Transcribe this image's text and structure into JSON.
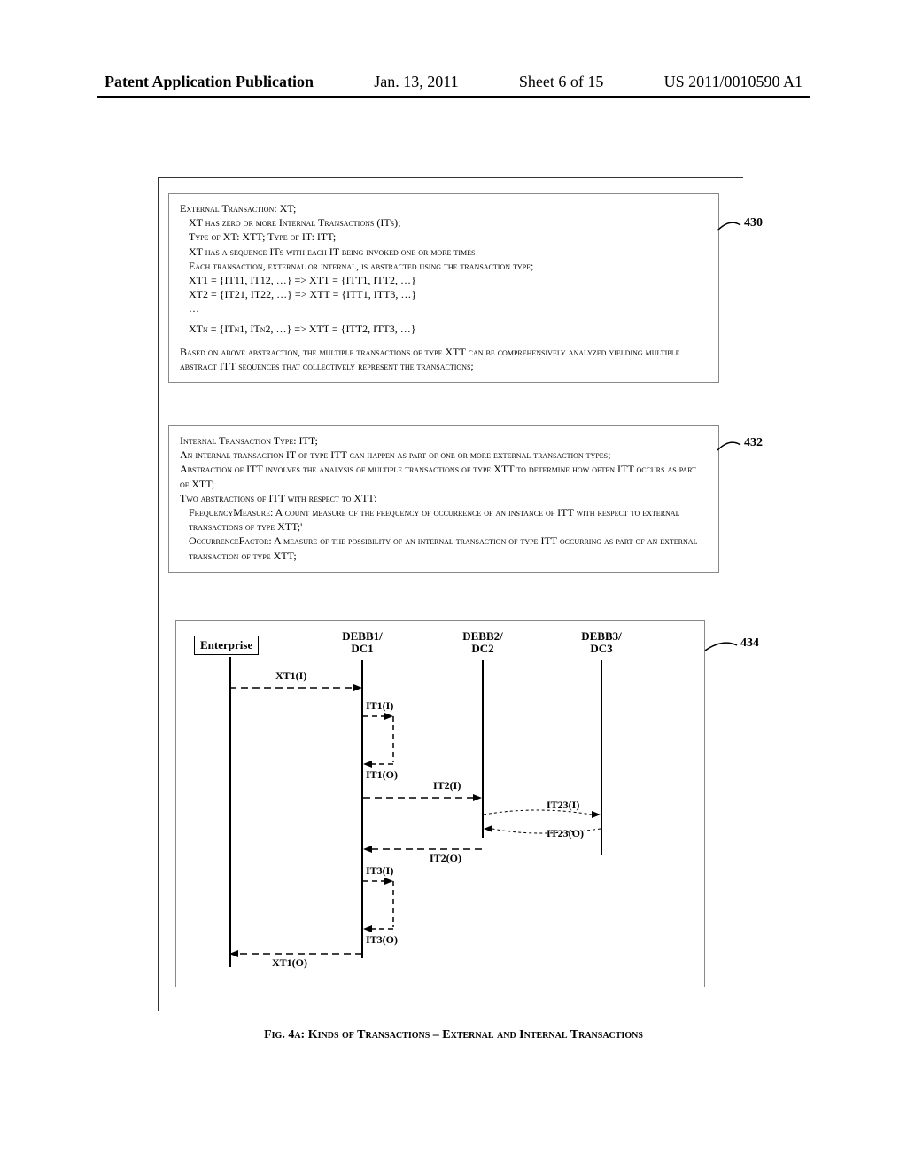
{
  "header": {
    "left": "Patent Application Publication",
    "date": "Jan. 13, 2011",
    "sheet": "Sheet 6 of 15",
    "pubno": "US 2011/0010590 A1"
  },
  "refs": {
    "r430": "430",
    "r432": "432",
    "r434": "434"
  },
  "box430": {
    "l1": "External Transaction: XT;",
    "l2": "XT has zero or more Internal Transactions (ITs);",
    "l3": "Type of XT: XTT; Type of IT: ITT;",
    "l4": "XT has a sequence ITs with each IT being invoked one or more times",
    "l5": "Each transaction, external or internal, is abstracted using the transaction type;",
    "l6": "XT1 = {IT11, IT12, …} => XTT = {ITT1, ITT2, …}",
    "l7": "XT2 = {IT21, IT22, …} => XTT = {ITT1, ITT3, …}",
    "l8": "…",
    "l9": "XTn = {ITn1, ITn2, …} => XTT = {ITT2, ITT3, …}",
    "l10": "Based on above abstraction, the multiple transactions of type XTT can be comprehensively analyzed yielding multiple abstract ITT sequences that collectively represent the transactions;"
  },
  "box432": {
    "l1": "Internal Transaction Type: ITT;",
    "l2": "An internal transaction IT of type ITT can happen as part of one or more external transaction  types;",
    "l3": "Abstraction of ITT involves the analysis of multiple transactions of type XTT to determine how often ITT occurs as part of XTT;",
    "l4": "Two abstractions of ITT with respect to XTT:",
    "l5": "FrequencyMeasure: A count measure of the frequency of occurrence of an instance of ITT with respect to external transactions of type XTT;'",
    "l6": "OccurrenceFactor: A measure of the possibility of an internal transaction of type ITT occurring as part of an external transaction of type XTT;"
  },
  "seq": {
    "heads": {
      "ent": "Enterprise",
      "d1a": "DEBB1/",
      "d1b": "DC1",
      "d2a": "DEBB2/",
      "d2b": "DC2",
      "d3a": "DEBB3/",
      "d3b": "DC3"
    },
    "labels": {
      "xt1i": "XT1(I)",
      "xt1o": "XT1(O)",
      "it1i": "IT1(I)",
      "it1o": "IT1(O)",
      "it2i": "IT2(I)",
      "it2o": "IT2(O)",
      "it3i": "IT3(I)",
      "it3o": "IT3(O)",
      "it23i": "IT23(I)",
      "it23o": "IT23(O)"
    }
  },
  "caption": "Fig. 4a: Kinds of Transactions – External and Internal Transactions"
}
